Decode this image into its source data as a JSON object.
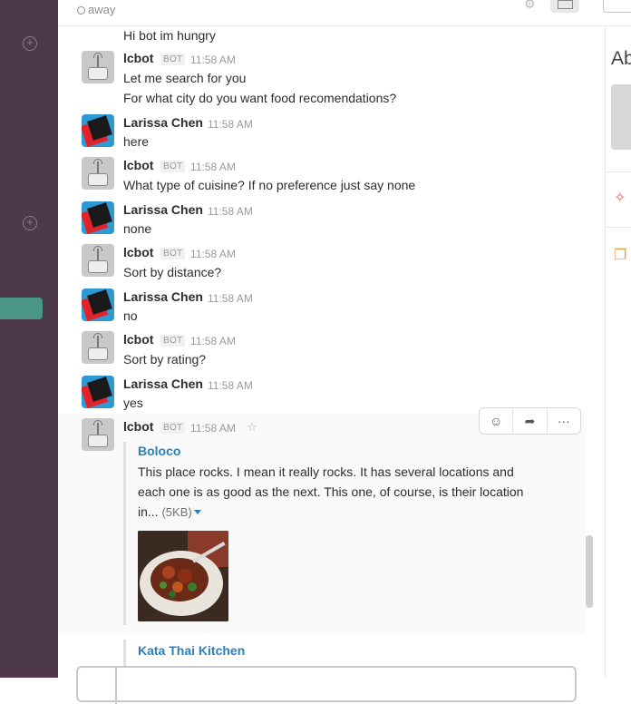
{
  "header": {
    "presence": "away"
  },
  "messages": [
    {
      "text": "Hi bot im hungry"
    },
    {
      "author": "lcbot",
      "badge": "BOT",
      "time": "11:58 AM",
      "lines": [
        "Let me search for you",
        "For what city do you want food recomendations?"
      ]
    },
    {
      "author": "Larissa Chen",
      "time": "11:58 AM",
      "lines": [
        "here"
      ]
    },
    {
      "author": "lcbot",
      "badge": "BOT",
      "time": "11:58 AM",
      "lines": [
        "What type of cuisine? If no preference just say none"
      ]
    },
    {
      "author": "Larissa Chen",
      "time": "11:58 AM",
      "lines": [
        "none"
      ]
    },
    {
      "author": "lcbot",
      "badge": "BOT",
      "time": "11:58 AM",
      "lines": [
        "Sort by distance?"
      ]
    },
    {
      "author": "Larissa Chen",
      "time": "11:58 AM",
      "lines": [
        "no"
      ]
    },
    {
      "author": "lcbot",
      "badge": "BOT",
      "time": "11:58 AM",
      "lines": [
        "Sort by rating?"
      ]
    },
    {
      "author": "Larissa Chen",
      "time": "11:58 AM",
      "lines": [
        "yes"
      ]
    },
    {
      "author": "lcbot",
      "badge": "BOT",
      "time": "11:58 AM"
    }
  ],
  "attachments": [
    {
      "title": "Boloco",
      "body": "This place rocks. I mean it really rocks. It has several locations and each one is as good as the next.  This one, of course, is their location in...",
      "size": "(5KB)"
    },
    {
      "title": "Kata Thai Kitchen"
    }
  ],
  "right_panel": {
    "heading": "Ab"
  },
  "colors": {
    "sidebar": "#4d394b",
    "link": "#2a80b9",
    "active_channel": "#4c9689"
  }
}
